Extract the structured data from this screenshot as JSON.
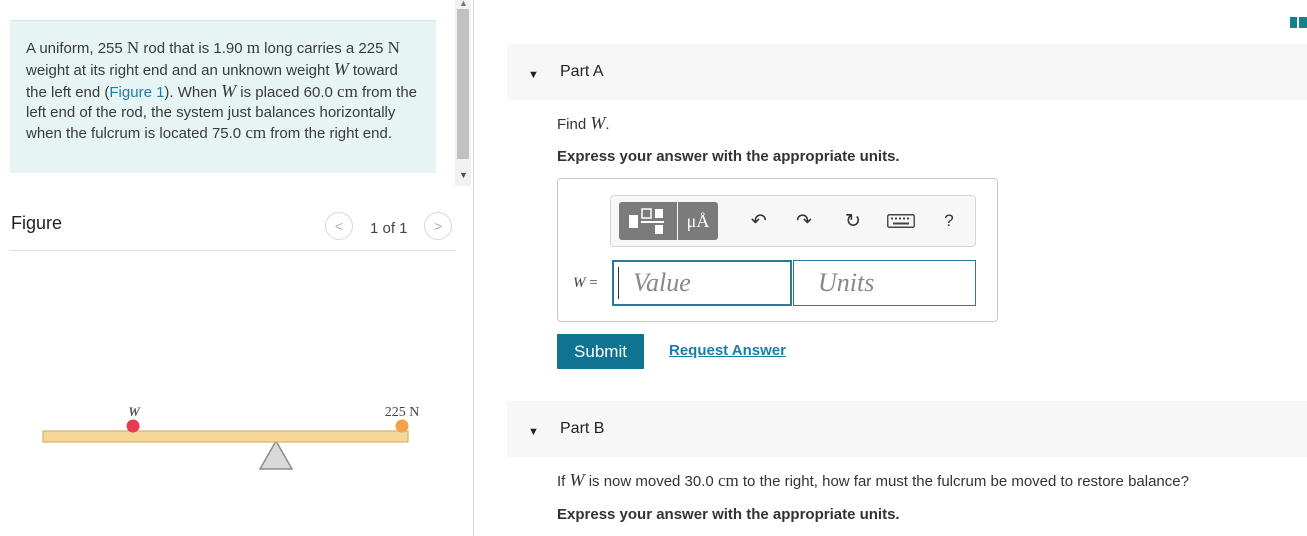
{
  "problem": {
    "p1": "A uniform, 255",
    "u_N1": "N",
    "p2": "rod that is 1.90",
    "u_m": "m",
    "p3": "long carries a",
    "p4": "225",
    "u_N2": "N",
    "p5": "weight at its right end and an unknown weight",
    "var_W1": "W",
    "p6": "toward the left end (",
    "figure_link": "Figure 1",
    "p7": "). When",
    "var_W2": "W",
    "p8": "is placed",
    "p9": "60.0",
    "u_cm1": "cm",
    "p10": "from the left end of the rod, the system just balances horizontally when the fulcrum is located",
    "p11": "75.0",
    "u_cm2": "cm",
    "p12": "from the right end."
  },
  "figure_panel": {
    "title": "Figure",
    "counter": "1 of 1",
    "prev_glyph": "<",
    "next_glyph": ">",
    "diagram": {
      "label_w": "W",
      "label_load": "225 N",
      "colors": {
        "rod": "#f5d79a",
        "rod_edge": "#d4b06c",
        "w_ball": "#e63a50",
        "load_ball": "#f0a34a",
        "fulcrum": "#d6d6d6"
      }
    }
  },
  "part_a": {
    "title": "Part A",
    "find_prefix": "Find",
    "find_var": "W",
    "find_suffix": ".",
    "express": "Express your answer with the appropriate units.",
    "toolbar": {
      "units_label": "μÅ",
      "undo_icon": "↶",
      "redo_icon": "↷",
      "reset_icon": "↻",
      "help_label": "?"
    },
    "answer_label_var": "W",
    "answer_label_eq": "=",
    "value_placeholder": "Value",
    "units_placeholder": "Units",
    "submit_label": "Submit",
    "request_label": "Request Answer"
  },
  "part_b": {
    "title": "Part B",
    "q1": "If",
    "q_var": "W",
    "q2": "is now moved 30.0",
    "q_unit": "cm",
    "q3": "to the right, how far must the fulcrum be moved to restore balance?",
    "express": "Express your answer with the appropriate units."
  },
  "caret_glyph": "▼",
  "colors": {
    "accent": "#0f7391",
    "link": "#1a7fa6",
    "problem_bg": "#e6f4f4",
    "corner_icon": "#13828a"
  }
}
